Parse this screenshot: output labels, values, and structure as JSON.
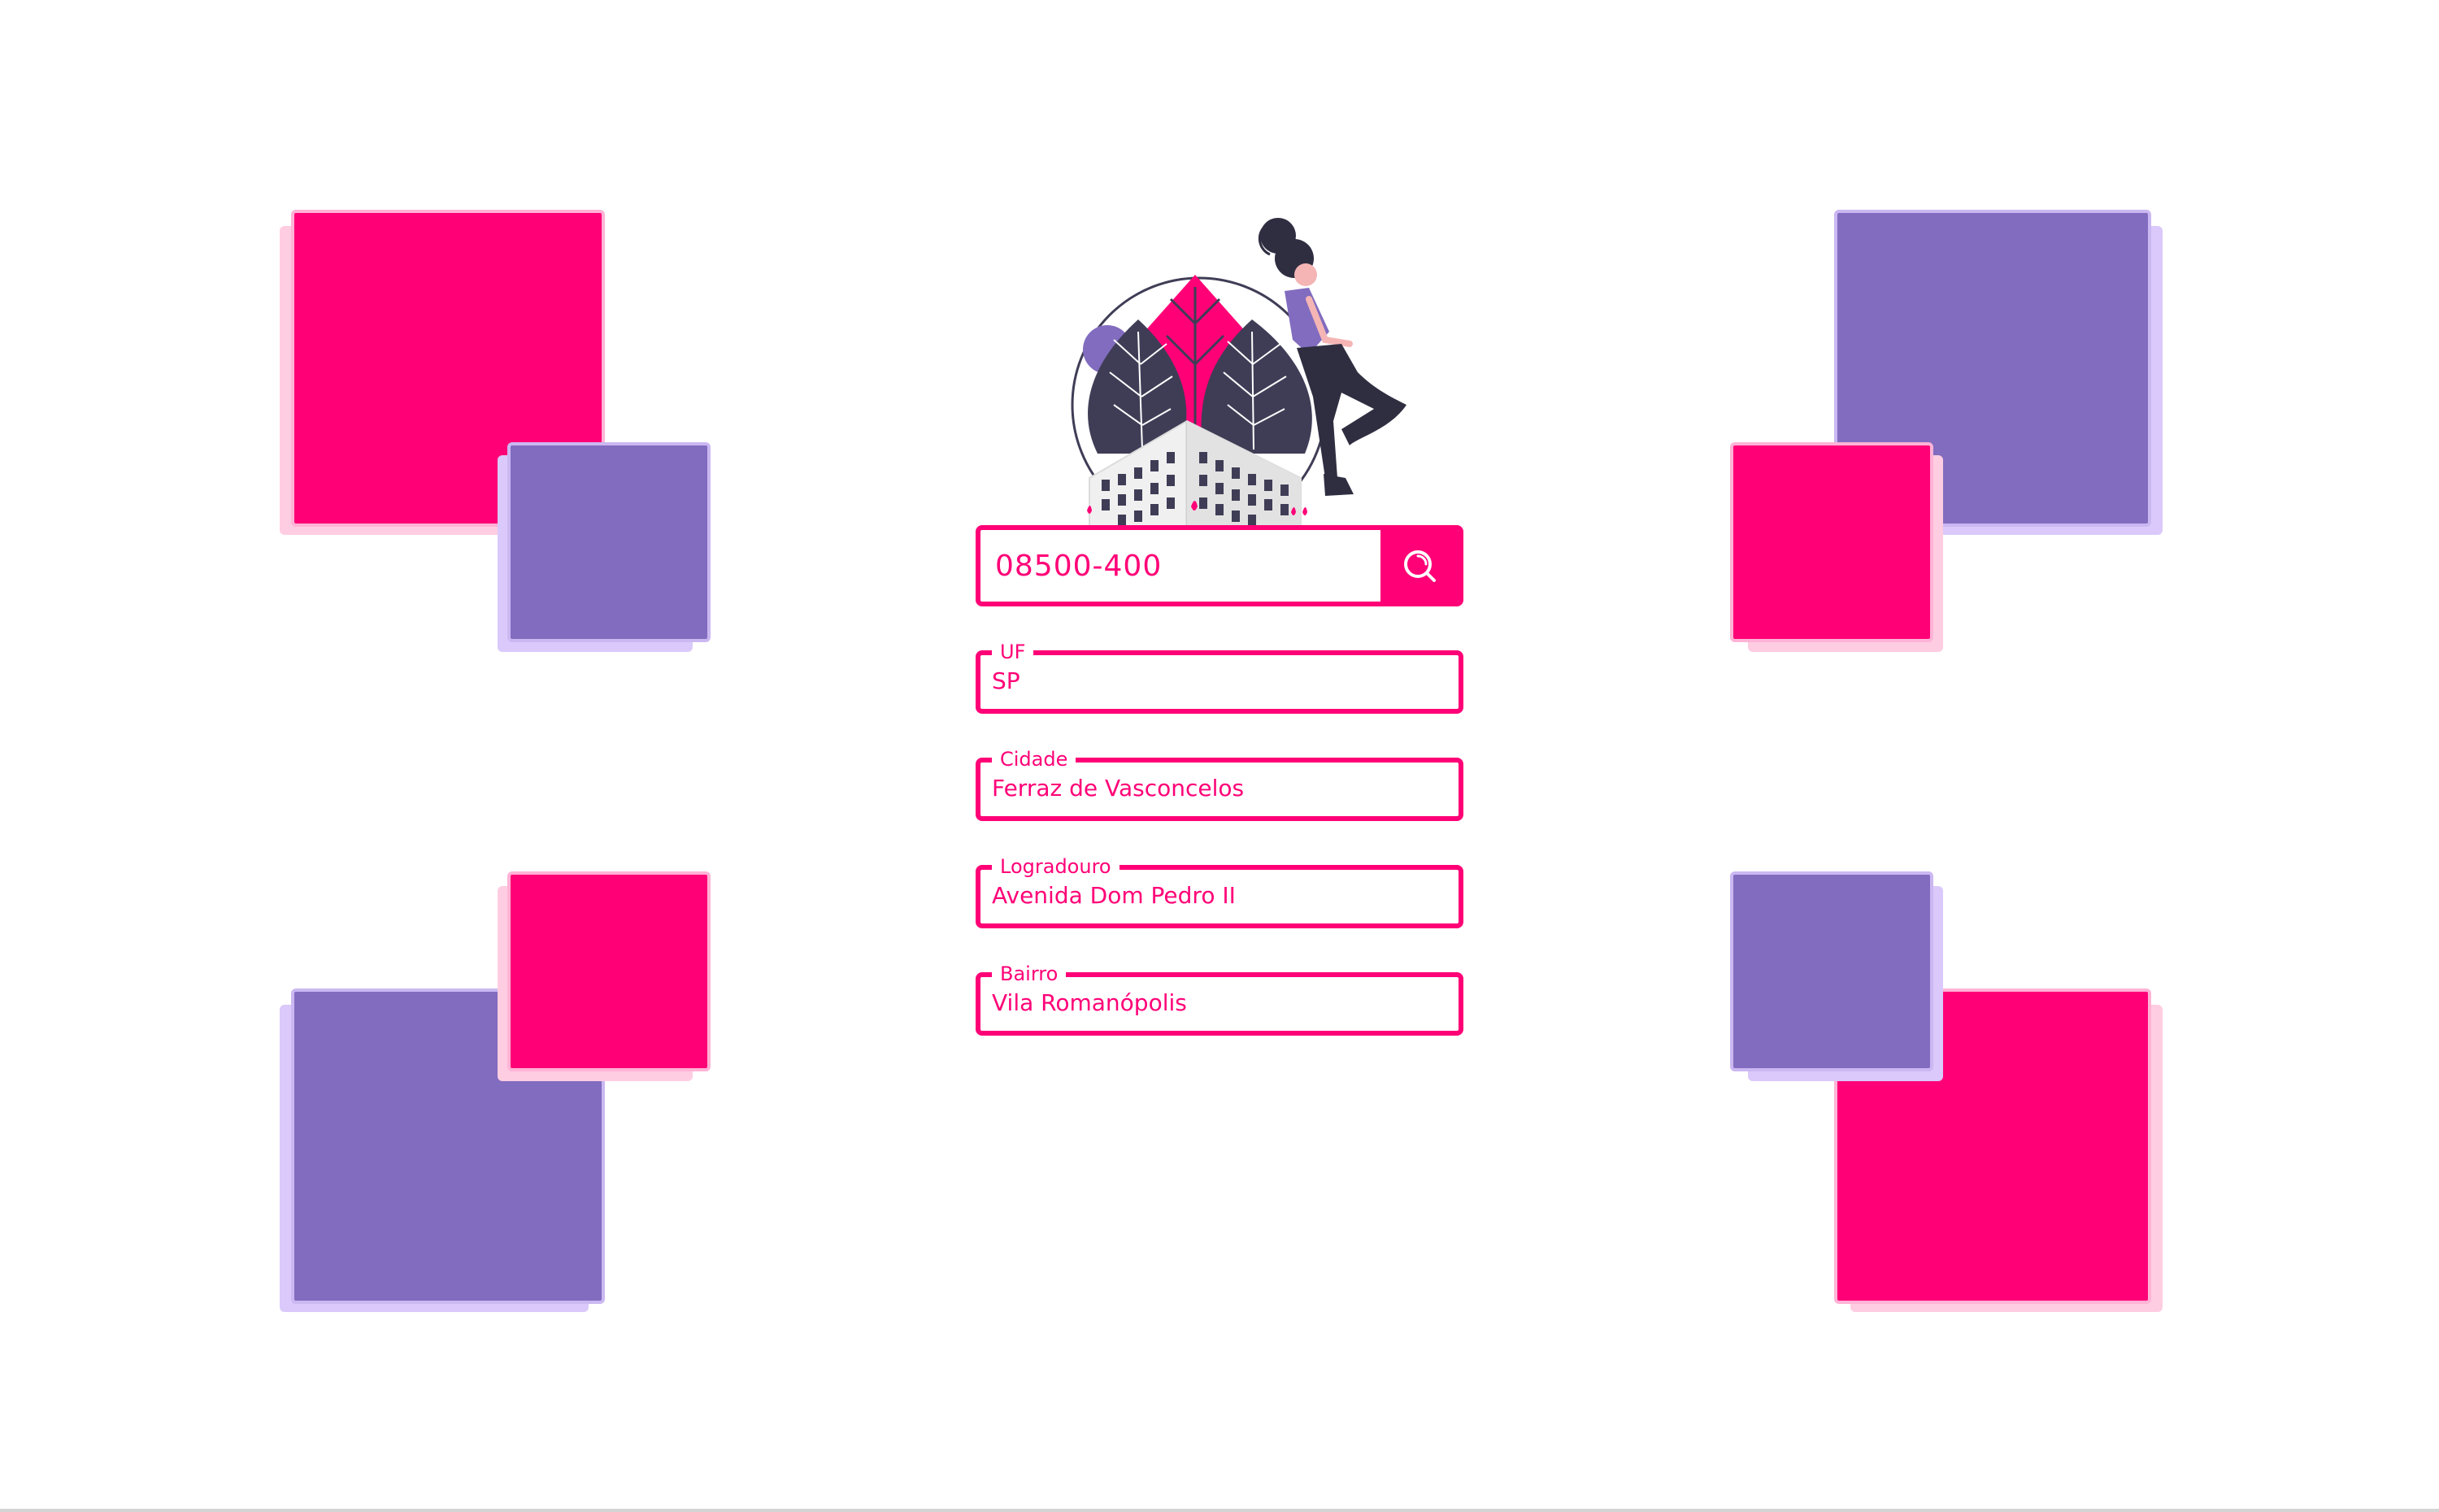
{
  "search": {
    "value": "08500-400",
    "button_icon": "search-icon"
  },
  "fields": {
    "uf": {
      "label": "UF",
      "value": "SP"
    },
    "cidade": {
      "label": "Cidade",
      "value": "Ferraz de Vasconcelos"
    },
    "logradouro": {
      "label": "Logradouro",
      "value": "Avenida Dom Pedro II"
    },
    "bairro": {
      "label": "Bairro",
      "value": "Vila Romanópolis"
    }
  },
  "colors": {
    "accent": "#ff0077",
    "purple": "#816cbf",
    "dark": "#3f3d56"
  },
  "illustration": "woman-leaning-on-building-globe-illustration"
}
